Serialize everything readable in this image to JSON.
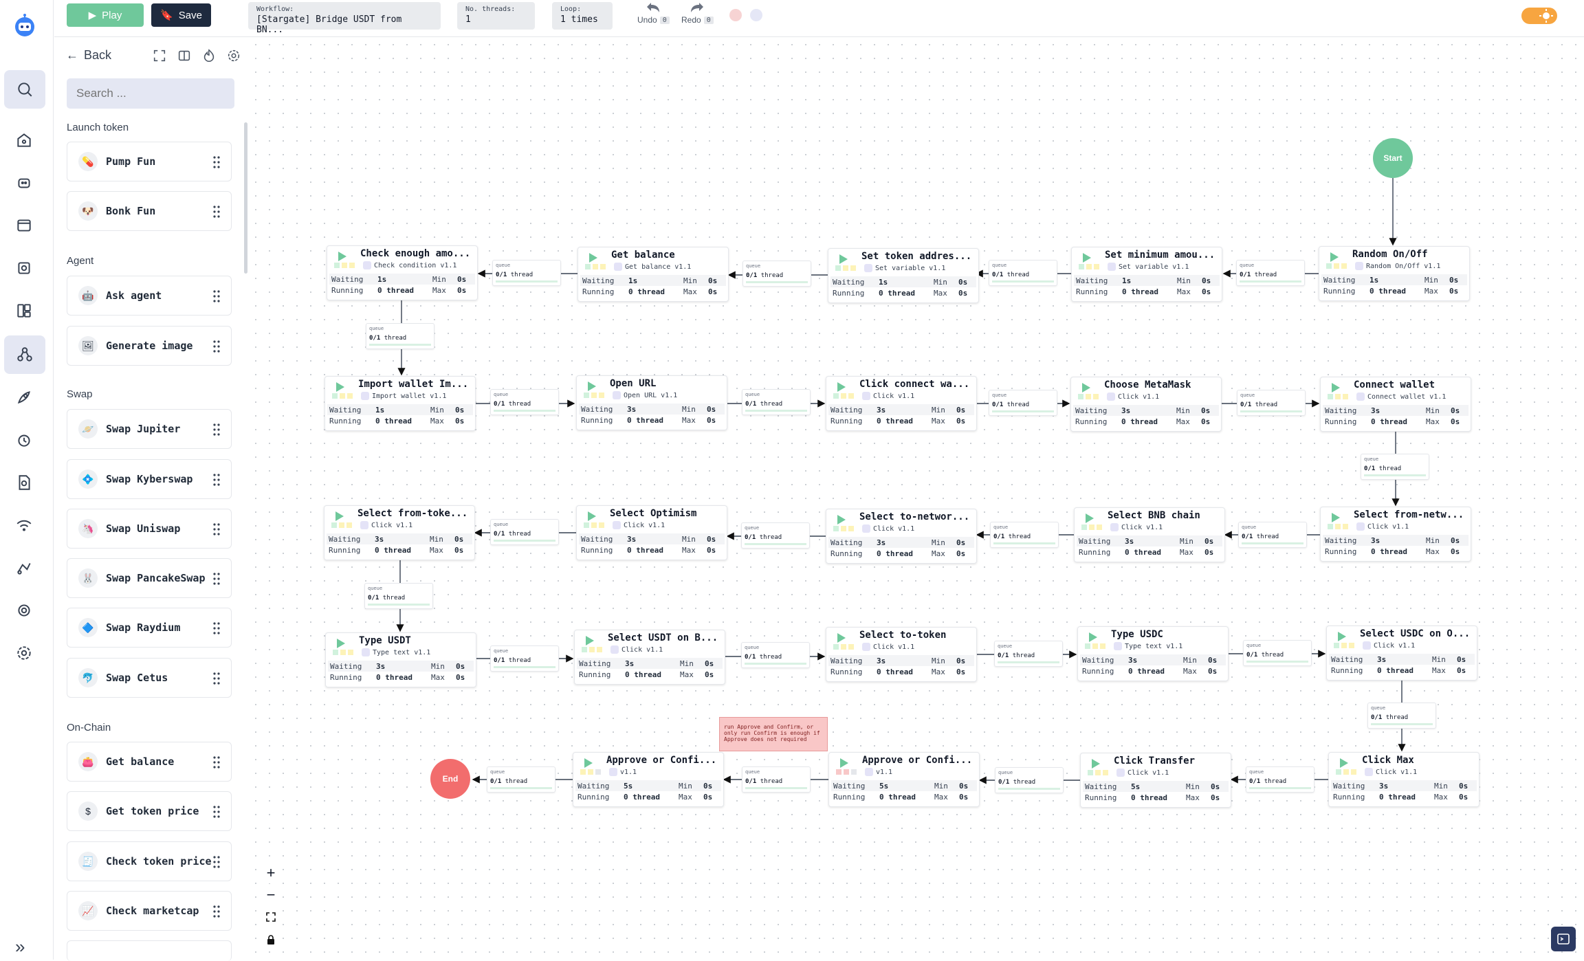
{
  "rail": {
    "items": [
      "search-icon",
      "home-icon",
      "bot-icon",
      "browser-icon",
      "scan-icon",
      "dashboard-icon",
      "workflow-icon",
      "rocket-icon",
      "alarm-icon",
      "doc-search-icon",
      "wifi-icon",
      "automation-icon",
      "target-icon",
      "settings-icon"
    ]
  },
  "panel": {
    "back_label": "Back",
    "search_placeholder": "Search ...",
    "sections": [
      {
        "title": "Launch token",
        "items": [
          "Pump Fun",
          "Bonk Fun"
        ]
      },
      {
        "title": "Agent",
        "items": [
          "Ask agent",
          "Generate image"
        ]
      },
      {
        "title": "Swap",
        "items": [
          "Swap Jupiter",
          "Swap Kyberswap",
          "Swap Uniswap",
          "Swap PancakeSwap",
          "Swap Raydium",
          "Swap Cetus"
        ]
      },
      {
        "title": "On-Chain",
        "items": [
          "Get balance",
          "Get token price",
          "Check token price",
          "Check marketcap"
        ]
      }
    ]
  },
  "topbar": {
    "play_label": "Play",
    "save_label": "Save",
    "workflow_key": "Workflow:",
    "workflow_value": "[Stargate] Bridge USDT from BN...",
    "threads_key": "No. threads:",
    "threads_value": "1",
    "loop_key": "Loop:",
    "loop_value": "1 times",
    "undo_label": "Undo",
    "undo_count": "0",
    "redo_label": "Redo",
    "redo_count": "0",
    "accent": "#6fc89b",
    "theme_toggle": "sun-icon"
  },
  "canvas": {
    "start_label": "Start",
    "end_label": "End",
    "queue_label": "queue",
    "queue_value": "0/1",
    "queue_unit": "thread",
    "waiting_label": "Waiting",
    "running_label": "Running",
    "min_label": "Min",
    "max_label": "Max",
    "note": "run Approve and Confirm, or only run Confirm is enough if Approve does not required",
    "nodes": [
      {
        "title": "Random On/Off",
        "sub": "Random On/Off v1.1",
        "wait": "1s",
        "run": "0 thread",
        "min": "0s",
        "max": "0s"
      },
      {
        "title": "Set minimum amou...",
        "sub": "Set variable v1.1",
        "wait": "1s",
        "run": "0 thread",
        "min": "0s",
        "max": "0s"
      },
      {
        "title": "Set token addres...",
        "sub": "Set variable v1.1",
        "wait": "1s",
        "run": "0 thread",
        "min": "0s",
        "max": "0s"
      },
      {
        "title": "Get balance",
        "sub": "Get balance v1.1",
        "wait": "1s",
        "run": "0 thread",
        "min": "0s",
        "max": "0s"
      },
      {
        "title": "Check enough amo...",
        "sub": "Check condition v1.1",
        "wait": "1s",
        "run": "0 thread",
        "min": "0s",
        "max": "0s"
      },
      {
        "title": "Import wallet Im...",
        "sub": "Import wallet v1.1",
        "wait": "1s",
        "run": "0 thread",
        "min": "0s",
        "max": "0s"
      },
      {
        "title": "Open URL",
        "sub": "Open URL v1.1",
        "wait": "3s",
        "run": "0 thread",
        "min": "0s",
        "max": "0s"
      },
      {
        "title": "Click connect wa...",
        "sub": "Click v1.1",
        "wait": "3s",
        "run": "0 thread",
        "min": "0s",
        "max": "0s"
      },
      {
        "title": "Choose MetaMask",
        "sub": "Click v1.1",
        "wait": "3s",
        "run": "0 thread",
        "min": "0s",
        "max": "0s"
      },
      {
        "title": "Connect wallet",
        "sub": "Connect wallet v1.1",
        "wait": "3s",
        "run": "0 thread",
        "min": "0s",
        "max": "0s"
      },
      {
        "title": "Select from-netw...",
        "sub": "Click v1.1",
        "wait": "3s",
        "run": "0 thread",
        "min": "0s",
        "max": "0s"
      },
      {
        "title": "Select BNB chain",
        "sub": "Click v1.1",
        "wait": "3s",
        "run": "0 thread",
        "min": "0s",
        "max": "0s"
      },
      {
        "title": "Select to-networ...",
        "sub": "Click v1.1",
        "wait": "3s",
        "run": "0 thread",
        "min": "0s",
        "max": "0s"
      },
      {
        "title": "Select Optimism",
        "sub": "Click v1.1",
        "wait": "3s",
        "run": "0 thread",
        "min": "0s",
        "max": "0s"
      },
      {
        "title": "Select from-toke...",
        "sub": "Click v1.1",
        "wait": "3s",
        "run": "0 thread",
        "min": "0s",
        "max": "0s"
      },
      {
        "title": "Type USDT",
        "sub": "Type text v1.1",
        "wait": "3s",
        "run": "0 thread",
        "min": "0s",
        "max": "0s"
      },
      {
        "title": "Select USDT on B...",
        "sub": "Click v1.1",
        "wait": "3s",
        "run": "0 thread",
        "min": "0s",
        "max": "0s"
      },
      {
        "title": "Select to-token",
        "sub": "Click v1.1",
        "wait": "3s",
        "run": "0 thread",
        "min": "0s",
        "max": "0s"
      },
      {
        "title": "Type USDC",
        "sub": "Type text v1.1",
        "wait": "3s",
        "run": "0 thread",
        "min": "0s",
        "max": "0s"
      },
      {
        "title": "Select USDC on O...",
        "sub": "Click v1.1",
        "wait": "3s",
        "run": "0 thread",
        "min": "0s",
        "max": "0s"
      },
      {
        "title": "Click Max",
        "sub": "Click v1.1",
        "wait": "3s",
        "run": "0 thread",
        "min": "0s",
        "max": "0s"
      },
      {
        "title": "Click Transfer",
        "sub": "Click v1.1",
        "wait": "5s",
        "run": "0 thread",
        "min": "0s",
        "max": "0s"
      },
      {
        "title": "Approve or Confi...",
        "sub": "v1.1",
        "wait": "5s",
        "run": "0 thread",
        "min": "0s",
        "max": "0s"
      },
      {
        "title": "Approve or Confi...",
        "sub": "v1.1",
        "wait": "5s",
        "run": "0 thread",
        "min": "0s",
        "max": "0s"
      }
    ],
    "zoom_controls": [
      "zoom-in-icon",
      "zoom-out-icon",
      "fit-view-icon",
      "lock-icon"
    ]
  }
}
